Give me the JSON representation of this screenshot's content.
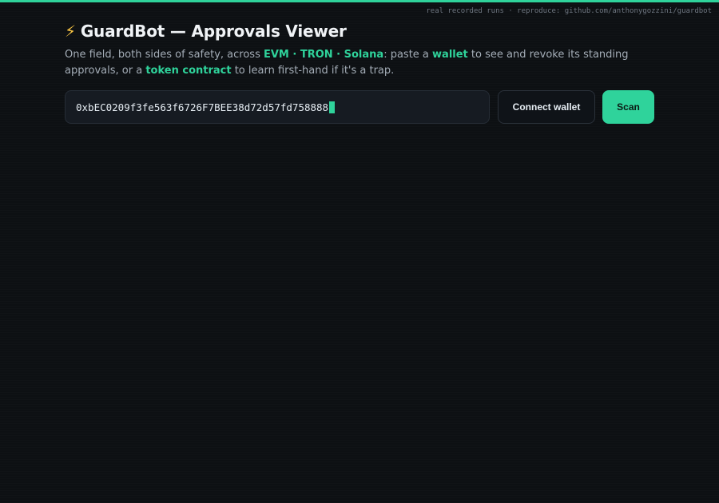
{
  "header": {
    "icon": "lightning-bolt-icon",
    "icon_glyph": "⚡",
    "title": "GuardBot — Approvals Viewer"
  },
  "footer_note": "real recorded runs · reproduce: github.com/anthonygozzini/guardbot",
  "subtitle": {
    "part1": "One field, both sides of safety, across ",
    "chains": "EVM · TRON · Solana",
    "part2": ": paste a ",
    "wallet": "wallet",
    "part3": " to see and revoke its standing approvals, or a ",
    "token_contract": "token contract",
    "part4": " to learn first-hand if it's a trap."
  },
  "search": {
    "value": "0xbEC0209f3fe563f6726F7BEE38d72d57fd758888"
  },
  "buttons": {
    "connect_wallet": "Connect wallet",
    "scan": "Scan"
  },
  "colors": {
    "accent": "#2fd39b",
    "background": "#0d1013",
    "input_bg": "#161b22",
    "text_primary": "#f0f3f6",
    "text_secondary": "#a4adb7",
    "bolt": "#f6c343"
  }
}
